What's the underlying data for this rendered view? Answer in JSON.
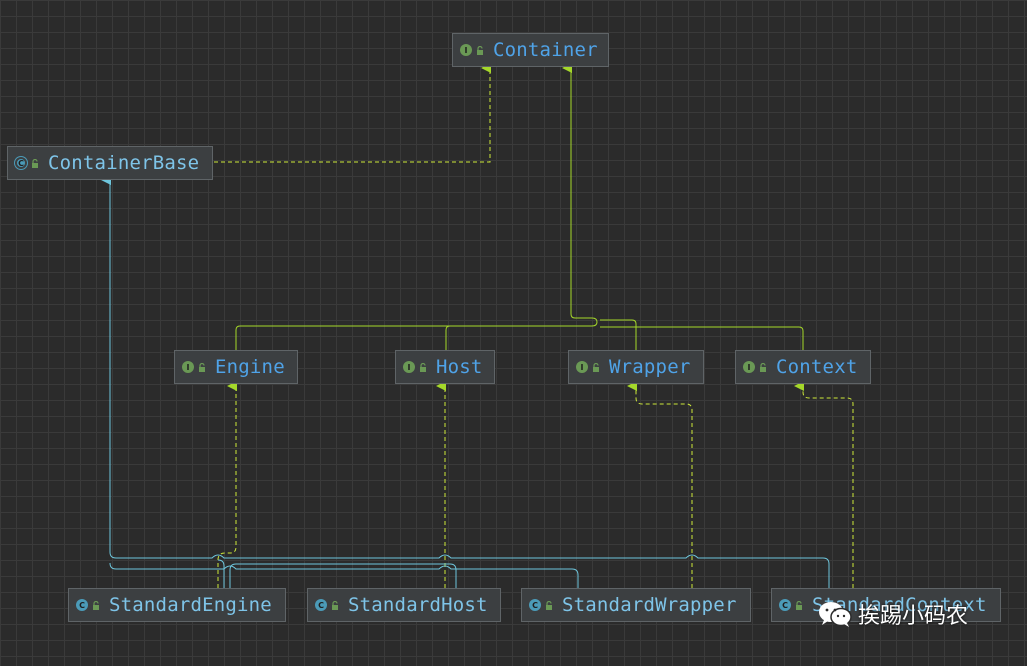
{
  "nodes": {
    "container": {
      "label": "Container",
      "badge": "I"
    },
    "containerbase": {
      "label": "ContainerBase",
      "badge": "C"
    },
    "engine": {
      "label": "Engine",
      "badge": "I"
    },
    "host": {
      "label": "Host",
      "badge": "I"
    },
    "wrapper": {
      "label": "Wrapper",
      "badge": "I"
    },
    "context": {
      "label": "Context",
      "badge": "I"
    },
    "standardengine": {
      "label": "StandardEngine",
      "badge": "C"
    },
    "standardhost": {
      "label": "StandardHost",
      "badge": "C"
    },
    "standardwrapper": {
      "label": "StandardWrapper",
      "badge": "C"
    },
    "standardcontext": {
      "label": "StandardContext",
      "badge": "C"
    }
  },
  "watermark": {
    "text": "挨踢小码农",
    "icon": "wechat-icon"
  },
  "colors": {
    "background": "#2b2b2b",
    "interface_label": "#4fa3e8",
    "class_label": "#7ec4e8",
    "extends_line": "#a5d82a",
    "implements_line": "#cde83a",
    "class_extends_line": "#6ec6dc"
  }
}
